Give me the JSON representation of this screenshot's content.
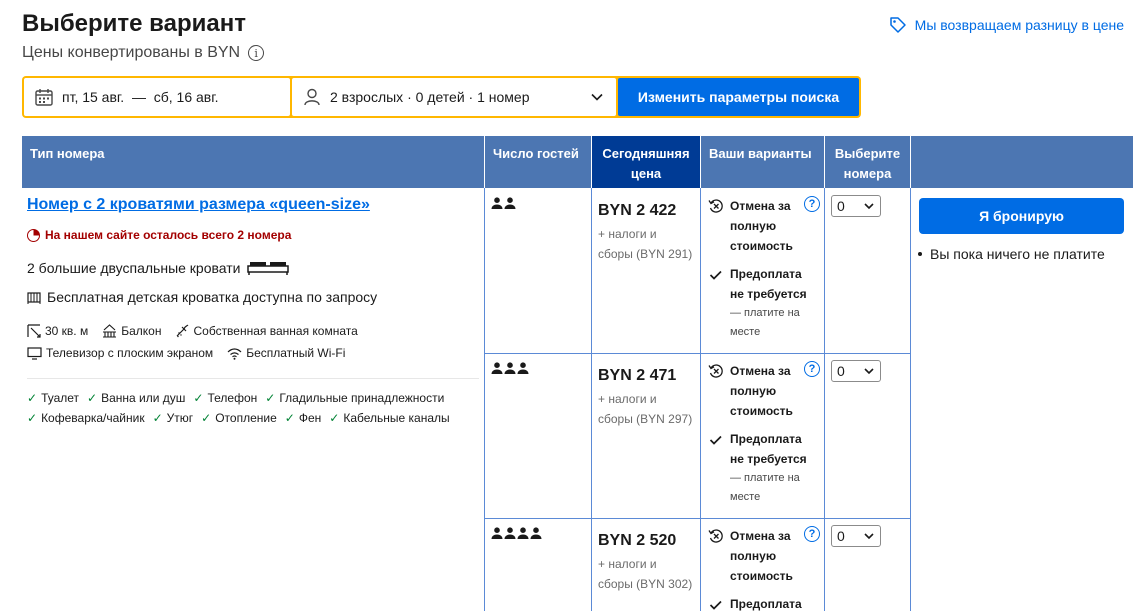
{
  "header": {
    "title": "Выберите вариант",
    "subtitle": "Цены конвертированы в BYN",
    "price_match": "Мы возвращаем разницу в цене"
  },
  "search": {
    "dates": "пт, 15 авг.  —  сб, 16 авг.",
    "guests": "2 взрослых · 0 детей · 1 номер",
    "button": "Изменить параметры поиска"
  },
  "table": {
    "headers": {
      "room_type": "Тип номера",
      "guests": "Число гостей",
      "today_price_line1": "Сегодняшняя",
      "today_price_line2": "цена",
      "options": "Ваши варианты",
      "select_line1": "Выберите",
      "select_line2": "номера"
    }
  },
  "room": {
    "name": "Номер с 2 кроватями размера «queen-size»",
    "scarcity": "На нашем сайте осталось всего 2 номера",
    "beds": "2 большие двуспальные кровати",
    "crib": "Бесплатная детская кроватка доступна по запросу",
    "facilities": [
      {
        "icon": "area-icon",
        "label": "30 кв. м"
      },
      {
        "icon": "balcony-icon",
        "label": "Балкон"
      },
      {
        "icon": "bathroom-icon",
        "label": "Собственная ванная комната"
      },
      {
        "icon": "tv-icon",
        "label": "Телевизор с плоским экраном"
      },
      {
        "icon": "wifi-icon",
        "label": "Бесплатный Wi-Fi"
      }
    ],
    "amenities": [
      "Туалет",
      "Ванна или душ",
      "Телефон",
      "Гладильные принадлежности",
      "Кофеварка/чайник",
      "Утюг",
      "Отопление",
      "Фен",
      "Кабельные каналы"
    ]
  },
  "rates": [
    {
      "guests": 2,
      "price": "BYN 2 422",
      "tax_line1": "+ налоги и",
      "tax_line2": "сборы (BYN 291)",
      "cancel_line1": "Отмена за",
      "cancel_line2": "полную",
      "cancel_line3": "стоимость",
      "prepay_line1": "Предоплата",
      "prepay_line2": "не требуется",
      "prepay_sub1": "— платите на",
      "prepay_sub2": "месте",
      "qty": "0"
    },
    {
      "guests": 3,
      "price": "BYN 2 471",
      "tax_line1": "+ налоги и",
      "tax_line2": "сборы (BYN 297)",
      "cancel_line1": "Отмена за",
      "cancel_line2": "полную",
      "cancel_line3": "стоимость",
      "prepay_line1": "Предоплата",
      "prepay_line2": "не требуется",
      "prepay_sub1": "— платите на",
      "prepay_sub2": "месте",
      "qty": "0"
    },
    {
      "guests": 4,
      "price": "BYN 2 520",
      "tax_line1": "+ налоги и",
      "tax_line2": "сборы (BYN 302)",
      "cancel_line1": "Отмена за",
      "cancel_line2": "полную",
      "cancel_line3": "стоимость",
      "prepay_line1": "Предоплата",
      "qty": "0"
    }
  ],
  "booking": {
    "button": "Я бронирую",
    "note": "Вы пока ничего не платите"
  },
  "colors": {
    "accent": "#006ce4",
    "header": "#4c76b2",
    "header_active": "#003b95",
    "search_border": "#ffb700",
    "scarcity": "#a30000",
    "check": "#008234"
  }
}
